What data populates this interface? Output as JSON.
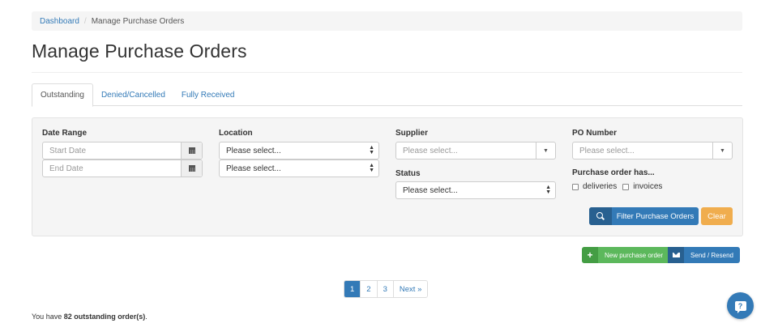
{
  "breadcrumb": {
    "home": "Dashboard",
    "separator": "/",
    "current": "Manage Purchase Orders"
  },
  "page_title": "Manage Purchase Orders",
  "tabs": [
    {
      "label": "Outstanding",
      "active": true
    },
    {
      "label": "Denied/Cancelled",
      "active": false
    },
    {
      "label": "Fully Received",
      "active": false
    }
  ],
  "filters": {
    "date_range": {
      "label": "Date Range",
      "start_placeholder": "Start Date",
      "end_placeholder": "End Date"
    },
    "location": {
      "label": "Location",
      "value_1": "Please select...",
      "value_2": "Please select..."
    },
    "supplier": {
      "label": "Supplier",
      "placeholder": "Please select..."
    },
    "status": {
      "label": "Status",
      "value": "Please select..."
    },
    "po_number": {
      "label": "PO Number",
      "placeholder": "Please select..."
    },
    "has": {
      "label": "Purchase order has...",
      "options": [
        "deliveries",
        "invoices"
      ]
    },
    "filter_button": "Filter Purchase Orders",
    "clear_button": "Clear"
  },
  "actions": {
    "new_po": "New purchase order",
    "send": "Send / Resend"
  },
  "pagination": {
    "pages": [
      "1",
      "2",
      "3"
    ],
    "next": "Next »",
    "active": "1"
  },
  "summary": {
    "prefix": "You have",
    "count_text": "82 outstanding order(s)",
    "suffix": "."
  },
  "icons": {
    "calendar": "calendar-icon",
    "search": "search-icon",
    "plus": "plus-icon",
    "envelope": "envelope-icon",
    "help": "help-chat-icon",
    "caret": "caret-down-icon"
  },
  "colors": {
    "primary": "#337ab7",
    "success": "#5cb85c",
    "warning": "#f0ad4e"
  }
}
